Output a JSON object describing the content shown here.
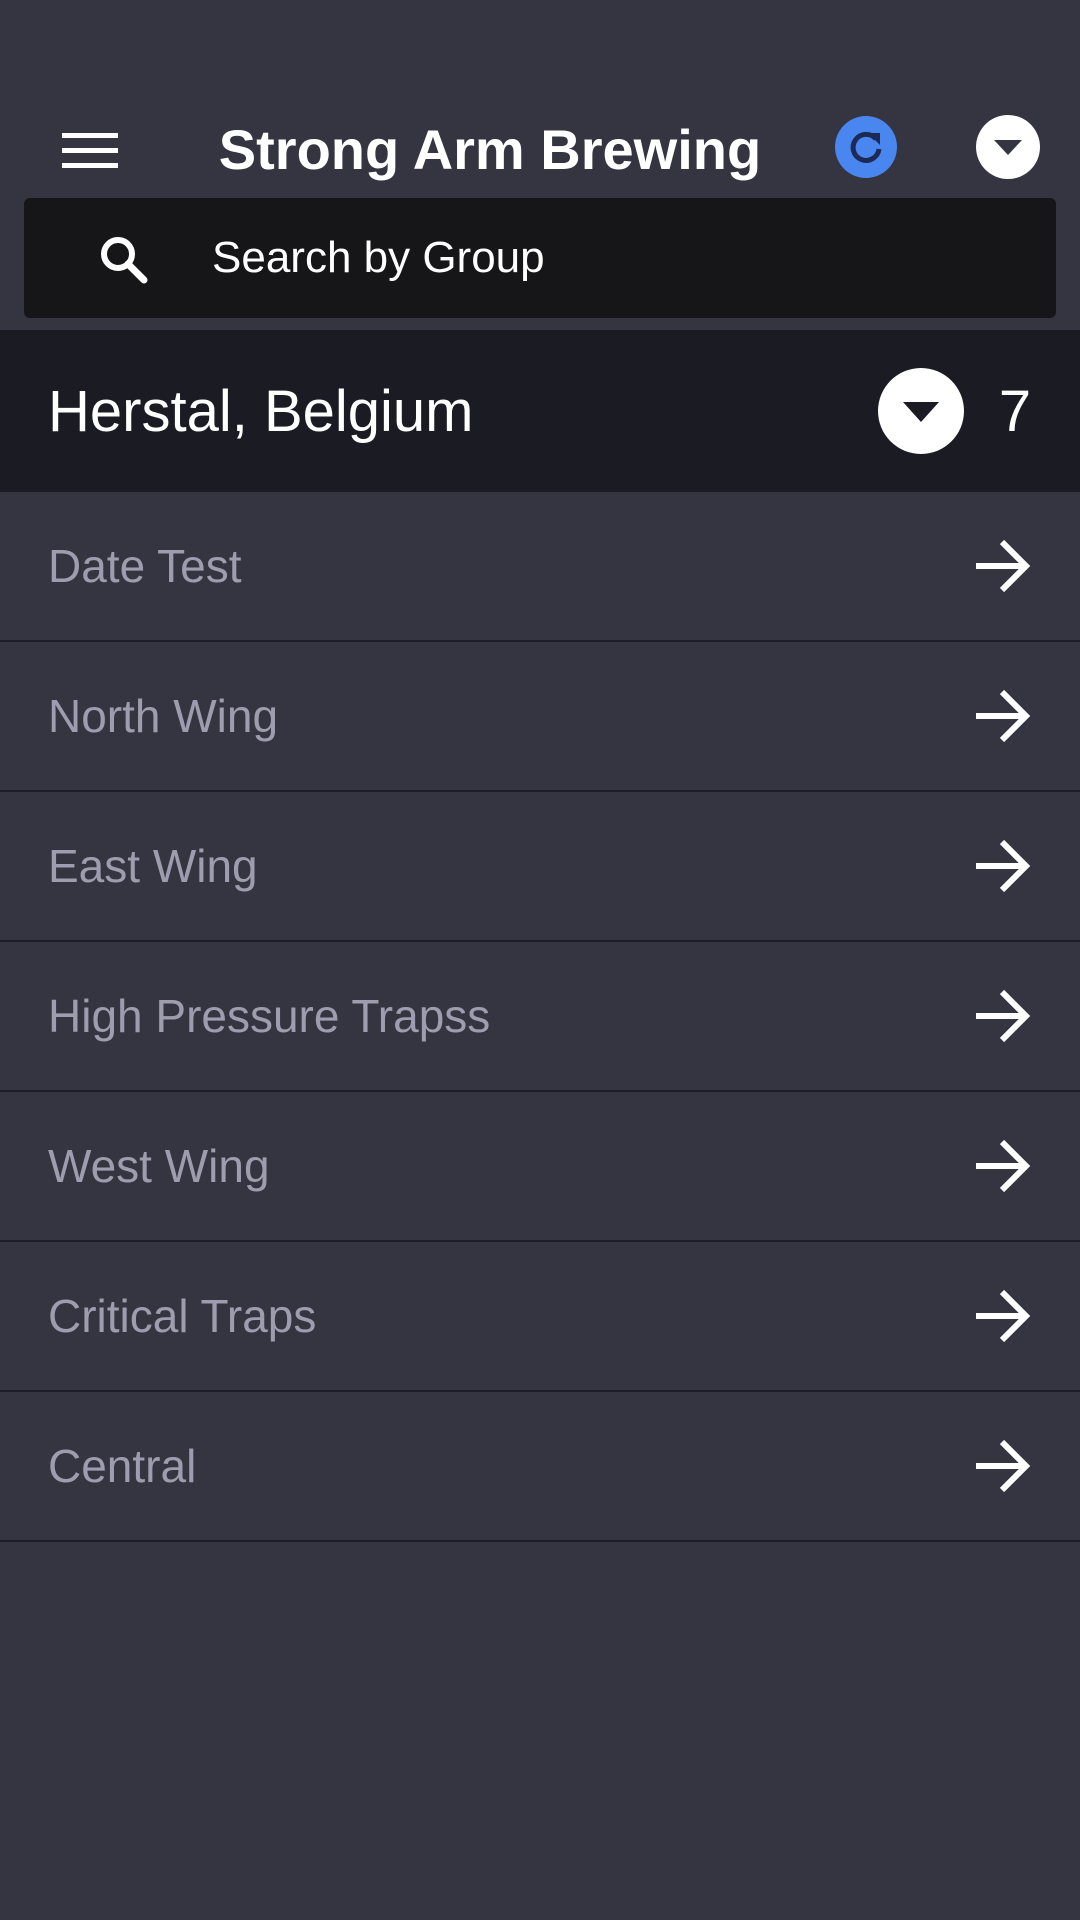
{
  "header": {
    "title": "Strong Arm Brewing",
    "menu_icon": "hamburger-menu-icon",
    "refresh_icon": "refresh-icon",
    "dropdown_icon": "caret-down-icon",
    "accent_color": "#4a86f0"
  },
  "search": {
    "placeholder": "Search by Group",
    "value": "",
    "icon": "search-icon"
  },
  "group": {
    "name": "Herstal, Belgium",
    "count": "7",
    "expanded": true,
    "toggle_icon": "caret-down-icon"
  },
  "items": [
    {
      "label": "Date Test"
    },
    {
      "label": "North Wing"
    },
    {
      "label": "East Wing"
    },
    {
      "label": "High Pressure Trapss"
    },
    {
      "label": "West Wing"
    },
    {
      "label": "Critical Traps"
    },
    {
      "label": "Central"
    }
  ],
  "colors": {
    "background": "#353541",
    "group_header_bg": "#1b1b23",
    "search_bg": "#161618",
    "item_text": "#9d9daf"
  }
}
